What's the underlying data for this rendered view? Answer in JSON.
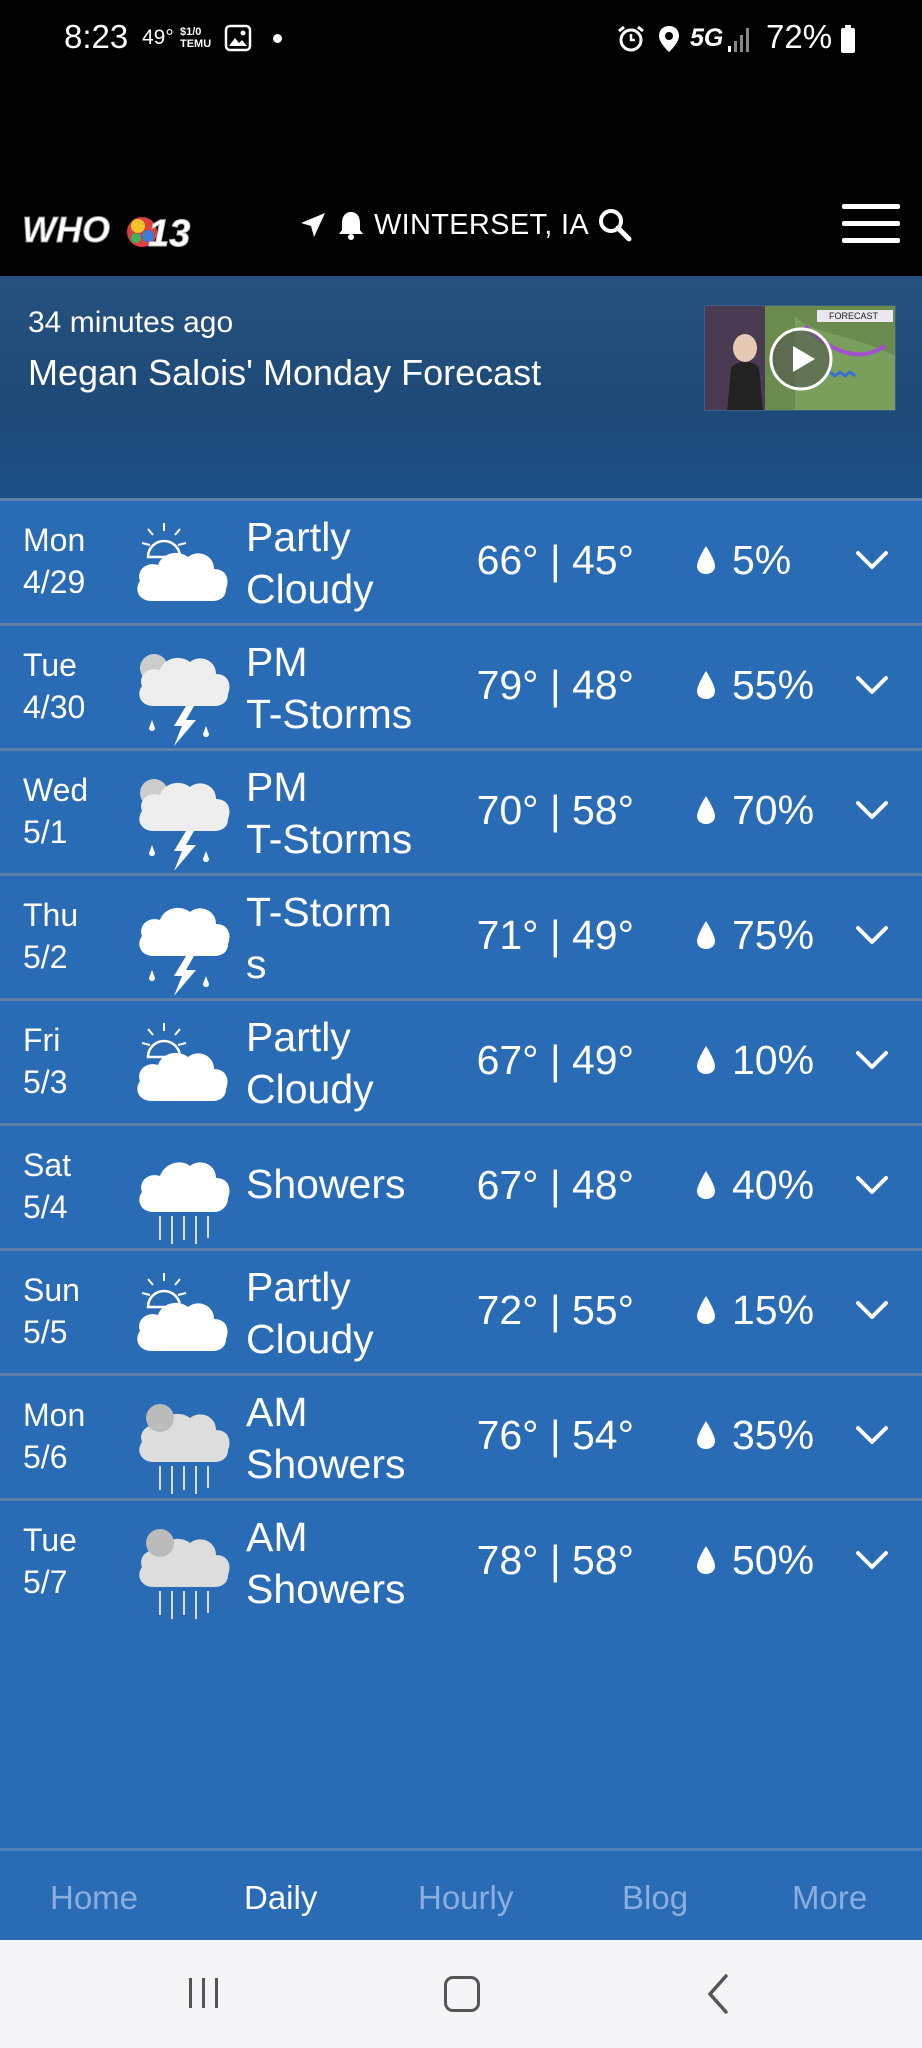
{
  "status_bar": {
    "time": "8:23",
    "temp": "49°",
    "temu": "$1/0\nTEMU",
    "signal": "5G",
    "battery": "72%"
  },
  "header": {
    "logo_text": "WHO13",
    "location": "WINTERSET, IA",
    "icons": [
      "navigation-arrow-icon",
      "bell-icon",
      "search-icon",
      "hamburger-menu-icon"
    ]
  },
  "video": {
    "time_ago": "34 minutes ago",
    "title": "Megan Salois' Monday Forecast",
    "thumb_label": "FORECAST"
  },
  "forecast": [
    {
      "day": "Mon",
      "date": "4/29",
      "icon": "partly-cloudy",
      "cond1": "Partly",
      "cond2": "Cloudy",
      "temps": "66° | 45°",
      "precip": "5%"
    },
    {
      "day": "Tue",
      "date": "4/30",
      "icon": "thunderstorm",
      "cond1": "PM",
      "cond2": "T-Storms",
      "temps": "79° | 48°",
      "precip": "55%"
    },
    {
      "day": "Wed",
      "date": "5/1",
      "icon": "thunderstorm",
      "cond1": "PM",
      "cond2": "T-Storms",
      "temps": "70° | 58°",
      "precip": "70%"
    },
    {
      "day": "Thu",
      "date": "5/2",
      "icon": "thunderstorm-full",
      "cond1": "T-Storm",
      "cond2": "s",
      "temps": "71° | 49°",
      "precip": "75%"
    },
    {
      "day": "Fri",
      "date": "5/3",
      "icon": "partly-cloudy",
      "cond1": "Partly",
      "cond2": "Cloudy",
      "temps": "67° | 49°",
      "precip": "10%"
    },
    {
      "day": "Sat",
      "date": "5/4",
      "icon": "showers",
      "cond1": "Showers",
      "cond2": "",
      "temps": "67° | 48°",
      "precip": "40%"
    },
    {
      "day": "Sun",
      "date": "5/5",
      "icon": "partly-cloudy",
      "cond1": "Partly",
      "cond2": "Cloudy",
      "temps": "72° | 55°",
      "precip": "15%"
    },
    {
      "day": "Mon",
      "date": "5/6",
      "icon": "am-showers",
      "cond1": "AM",
      "cond2": "Showers",
      "temps": "76° | 54°",
      "precip": "35%"
    },
    {
      "day": "Tue",
      "date": "5/7",
      "icon": "am-showers",
      "cond1": "AM",
      "cond2": "Showers",
      "temps": "78° | 58°",
      "precip": "50%"
    }
  ],
  "bottom_nav": [
    "Home",
    "Daily",
    "Hourly",
    "Blog",
    "More"
  ],
  "bottom_nav_active": "Daily",
  "colors": {
    "list_bg": "#2a6bb5",
    "header_bg": "#000000",
    "banner_bg": "#1e4a78",
    "inactive_nav": "#8aaee0"
  }
}
